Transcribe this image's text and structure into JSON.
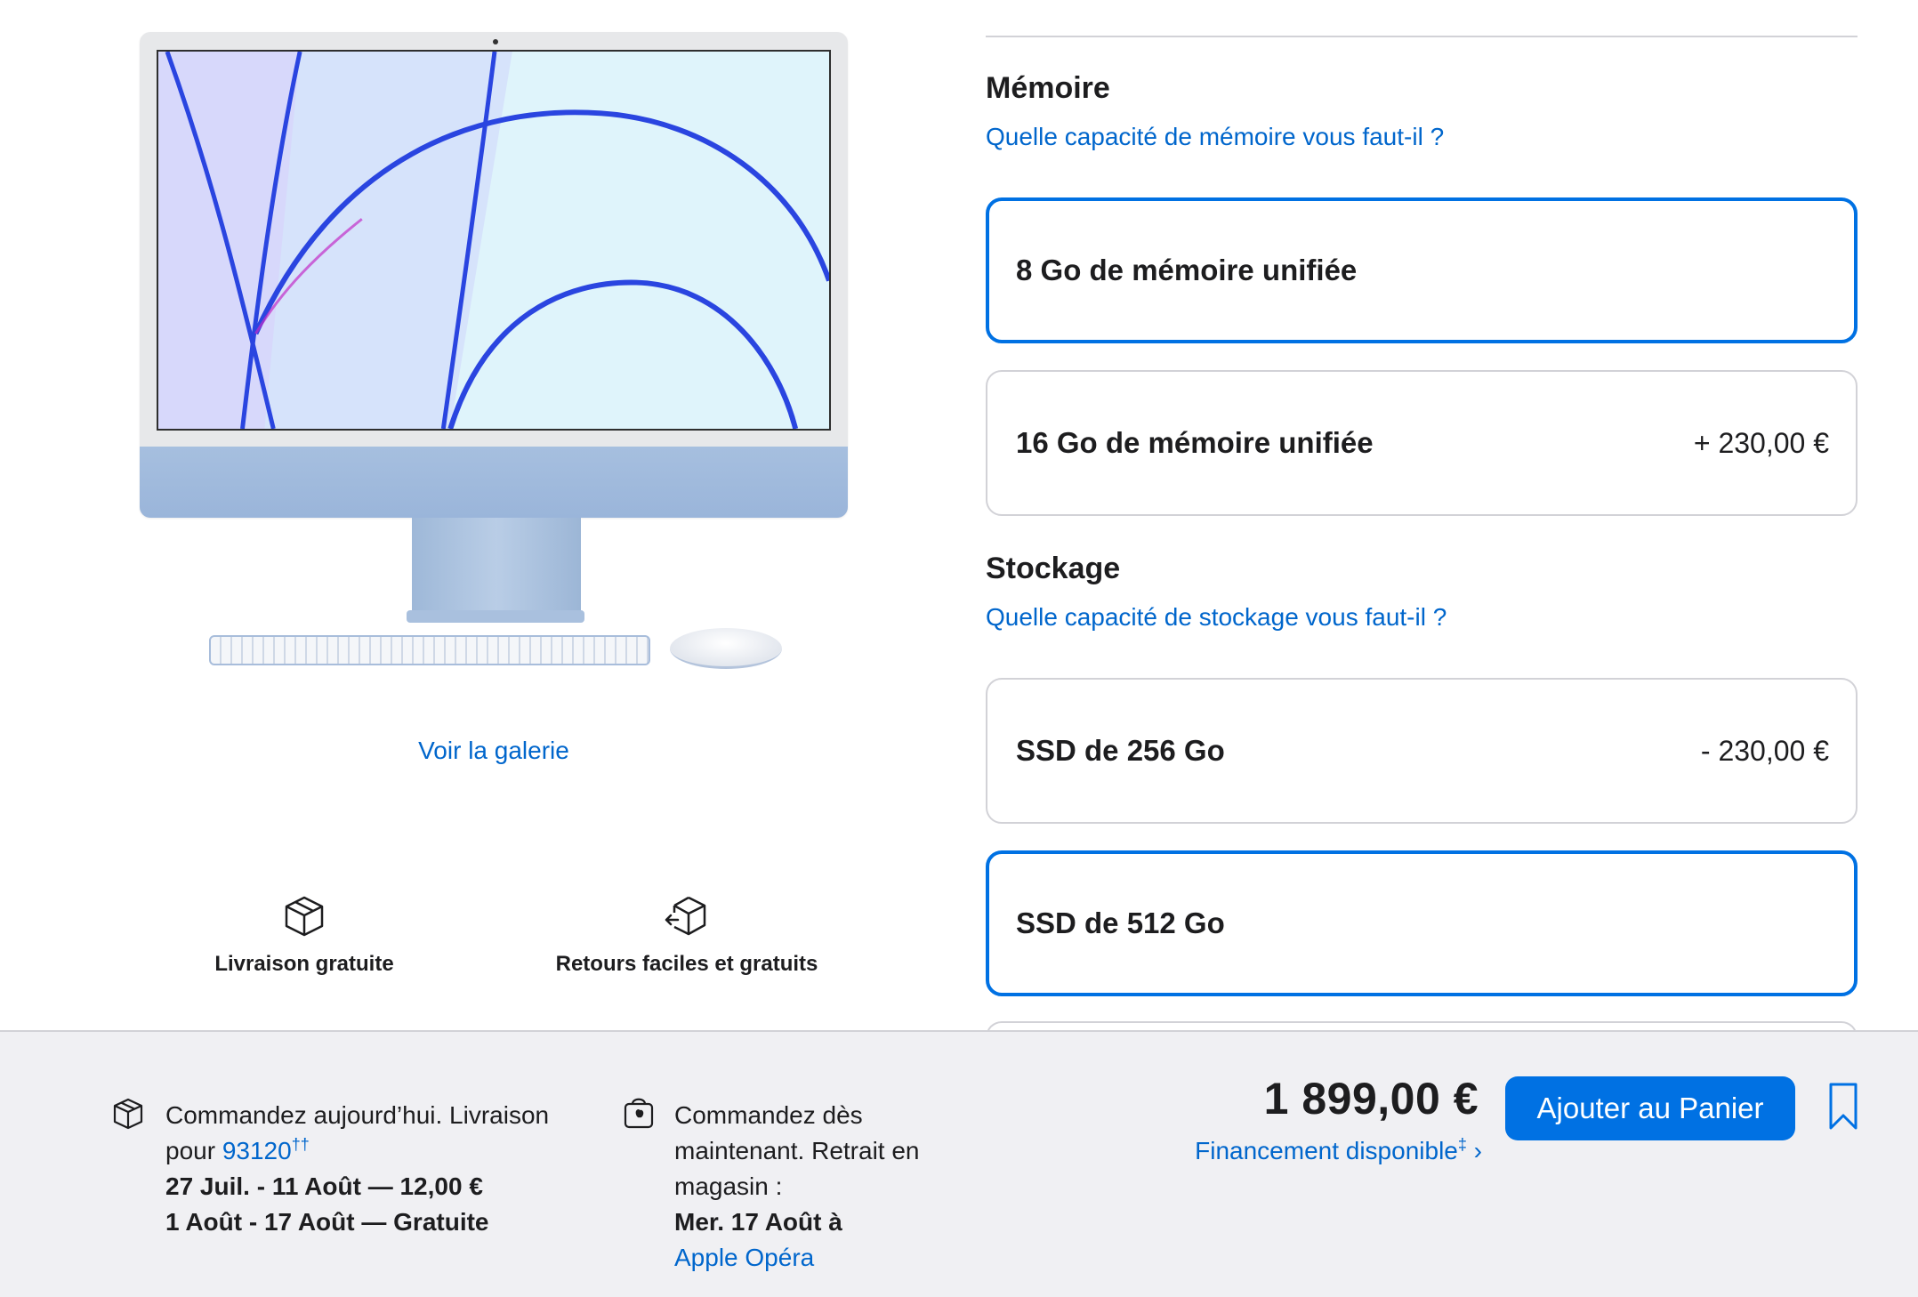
{
  "product": {
    "gallery_link": "Voir la galerie",
    "accent_color": "#a6bfdf"
  },
  "features": [
    {
      "icon": "box-icon",
      "label": "Livraison gratuite"
    },
    {
      "icon": "return-box-icon",
      "label": "Retours faciles et gratuits"
    }
  ],
  "memory": {
    "title": "Mémoire",
    "help": "Quelle capacité de mémoire vous faut-il ?",
    "options": [
      {
        "label": "8 Go de mémoire unifiée",
        "price": "",
        "selected": true
      },
      {
        "label": "16 Go de mémoire unifiée",
        "price": "+ 230,00 €",
        "selected": false
      }
    ]
  },
  "storage": {
    "title": "Stockage",
    "help": "Quelle capacité de stockage vous faut-il ?",
    "options": [
      {
        "label": "SSD de 256 Go",
        "price": "- 230,00 €",
        "selected": false
      },
      {
        "label": "SSD de 512 Go",
        "price": "",
        "selected": true
      }
    ]
  },
  "delivery": {
    "icon": "box-icon",
    "line1": "Commandez aujourd’hui. Livraison",
    "line2_prefix": "pour",
    "zip": "93120",
    "zip_sup": "††",
    "option1": "27 Juil. - 11 Août — 12,00 €",
    "option2": "1 Août - 17 Août — Gratuite"
  },
  "pickup": {
    "icon": "shopping-bag-icon",
    "line1": "Commandez dès",
    "line2": "maintenant. Retrait en",
    "line3": "magasin :",
    "date": "Mer. 17 Août à",
    "store": "Apple Opéra"
  },
  "checkout": {
    "price": "1 899,00 €",
    "financing": "Financement disponible",
    "financing_sup": "‡",
    "financing_chevron": "›",
    "add_to_cart": "Ajouter au Panier",
    "button_color": "#0071e3",
    "link_color": "#0066cc"
  }
}
